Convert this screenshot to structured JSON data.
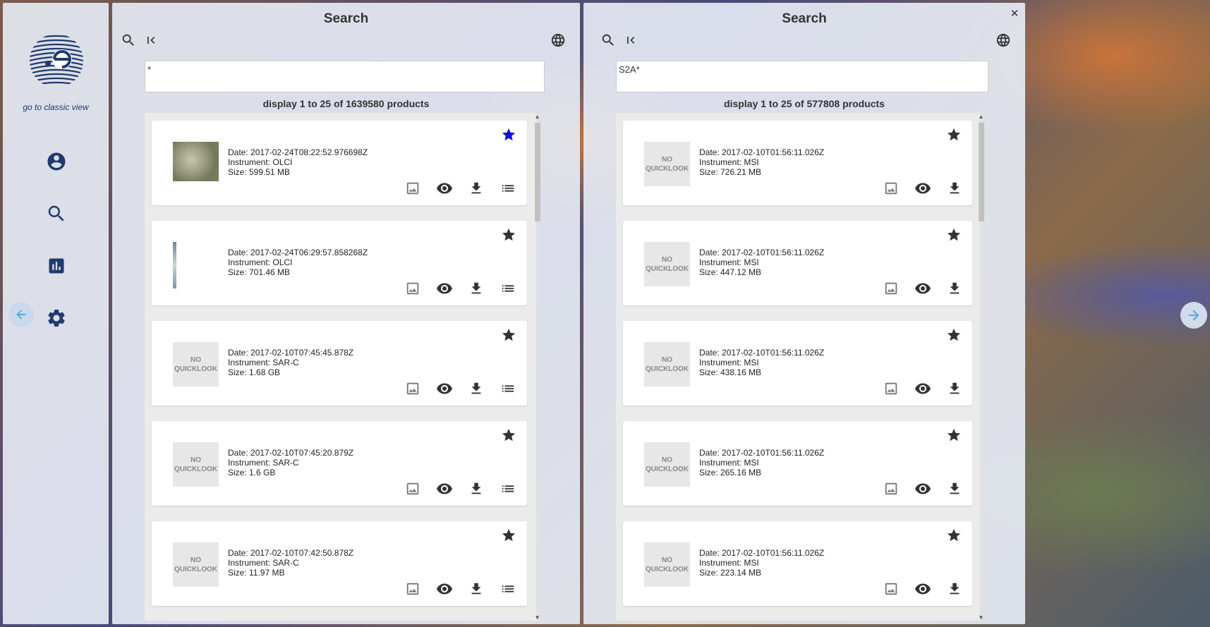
{
  "sidebar": {
    "classic_link": "go to classic view",
    "nav": [
      {
        "icon": "account-icon"
      },
      {
        "icon": "search-icon"
      },
      {
        "icon": "statistics-icon"
      },
      {
        "icon": "settings-icon"
      }
    ]
  },
  "colors": {
    "brand": "#1f3b6e",
    "favorite_active": "#1010dd",
    "arrow": "#4aa3df"
  },
  "panels": [
    {
      "title": "Search",
      "query": "*",
      "count_text": "display 1 to 25 of 1639580 products",
      "items": [
        {
          "quicklook": "image",
          "date": "Date: 2017-02-24T08:22:52.976698Z",
          "instrument": "Instrument: OLCI",
          "size": "Size: 599.51 MB",
          "favorite": true
        },
        {
          "quicklook": "image-strip",
          "date": "Date: 2017-02-24T06:29:57.858268Z",
          "instrument": "Instrument: OLCI",
          "size": "Size: 701.46 MB",
          "favorite": false
        },
        {
          "quicklook": "none",
          "date": "Date: 2017-02-10T07:45:45.878Z",
          "instrument": "Instrument: SAR-C",
          "size": "Size: 1.68 GB",
          "favorite": false
        },
        {
          "quicklook": "none",
          "date": "Date: 2017-02-10T07:45:20.879Z",
          "instrument": "Instrument: SAR-C",
          "size": "Size: 1.6 GB",
          "favorite": false
        },
        {
          "quicklook": "none",
          "date": "Date: 2017-02-10T07:42:50.878Z",
          "instrument": "Instrument: SAR-C",
          "size": "Size: 11.97 MB",
          "favorite": false
        }
      ]
    },
    {
      "title": "Search",
      "query": "S2A*",
      "count_text": "display 1 to 25 of 577808 products",
      "items": [
        {
          "quicklook": "none",
          "date": "Date: 2017-02-10T01:56:11.026Z",
          "instrument": "Instrument: MSI",
          "size": "Size: 726.21 MB",
          "favorite": false
        },
        {
          "quicklook": "none",
          "date": "Date: 2017-02-10T01:56:11.026Z",
          "instrument": "Instrument: MSI",
          "size": "Size: 447.12 MB",
          "favorite": false
        },
        {
          "quicklook": "none",
          "date": "Date: 2017-02-10T01:56:11.026Z",
          "instrument": "Instrument: MSI",
          "size": "Size: 438.16 MB",
          "favorite": false
        },
        {
          "quicklook": "none",
          "date": "Date: 2017-02-10T01:56:11.026Z",
          "instrument": "Instrument: MSI",
          "size": "Size: 265.16 MB",
          "favorite": false
        },
        {
          "quicklook": "none",
          "date": "Date: 2017-02-10T01:56:11.026Z",
          "instrument": "Instrument: MSI",
          "size": "Size: 223.14 MB",
          "favorite": false
        }
      ]
    }
  ],
  "no_quicklook_label": "NO\nQUICKLOOK"
}
